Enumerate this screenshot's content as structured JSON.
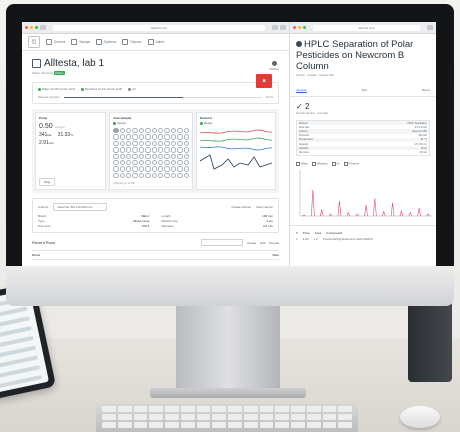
{
  "left": {
    "url": "Alltesta.com",
    "nav": [
      "Devices",
      "Sample",
      "Systems",
      "Reports",
      "Admin"
    ],
    "title": "Alltesta, lab 1",
    "subtitle": "Status: Running",
    "status_pill": "Online",
    "settings_label": "Setting",
    "conditions": [
      "Water  (0.1% formic acid)",
      "Methanol (0.1% formic acid)",
      "Air"
    ],
    "progress_label": "Sample injection",
    "progress_value": "60 %",
    "stop_label": "Stop",
    "panels": {
      "pump": {
        "title": "Pump",
        "value": "0.50",
        "unit": "mL/min",
        "pressure": "341",
        "pressure_unit": "bar",
        "temp": "31.33",
        "temp_unit": "°C",
        "eta": "2.91",
        "eta_unit": "min",
        "stop": "Stop"
      },
      "autosampler": {
        "title": "Autosampler",
        "status": "Ready",
        "label": "Injecting 1 of 96"
      },
      "detector": {
        "title": "Detector",
        "status": "Ready"
      }
    },
    "column": {
      "label": "Column",
      "selected": "Newcrom BH 3.0x100 mm",
      "create": "Create column",
      "view": "View column"
    },
    "column_fields": [
      [
        "Brand",
        "SIELC"
      ],
      [
        "Length",
        "100 mm"
      ],
      [
        "Type",
        "Mixed-mode"
      ],
      [
        "Particle size",
        "3 µm"
      ],
      [
        "Pore size",
        "100 Å"
      ],
      [
        "Diameter",
        "3.0 mm"
      ]
    ],
    "recent": {
      "title": "Recent Runs",
      "search_placeholder": "Search",
      "col1": "Name",
      "col2": "Date",
      "actions": [
        "Create",
        "Edit",
        "Repeat"
      ]
    }
  },
  "right": {
    "url": "alltesta.com",
    "title": "HPLC Separation of Polar Pesticides on Newcrom B Column",
    "meta": "Sample · Created · Newcrom BH",
    "tabs": [
      "Injection",
      "Run",
      "Rerun"
    ],
    "run_number": "2",
    "run_sub": "Sample injection · Complete",
    "rows": [
      [
        "Method",
        "HPLC Separation"
      ],
      [
        "Flow rate",
        "0.5 mL/min"
      ],
      [
        "Column",
        "Newcrom BH"
      ],
      [
        "Pressure",
        "341 bar"
      ],
      [
        "Temperature",
        "31 °C"
      ],
      [
        "Detector",
        "UV 270 nm"
      ],
      [
        "Injection",
        "10 µL"
      ],
      [
        "Run time",
        "15 min"
      ]
    ],
    "legend": [
      "Water",
      "Methanol",
      "Air",
      "Pressure"
    ],
    "peaks_title": "Peaks",
    "peaks_cols": [
      "#",
      "Time",
      "Area",
      "Compound"
    ],
    "peak_row": [
      "1",
      "4.03",
      "1.2",
      "Aminomethylphosphonic acid (AMPA)"
    ]
  },
  "chart_data": {
    "type": "line",
    "x": [
      0,
      1,
      2,
      3,
      4,
      5,
      6,
      7,
      8,
      9,
      10,
      11,
      12,
      13,
      14
    ],
    "values": [
      0.02,
      0.6,
      0.15,
      0.05,
      0.35,
      0.08,
      0.05,
      0.25,
      0.4,
      0.1,
      0.3,
      0.12,
      0.08,
      0.18,
      0.05
    ],
    "ylim": [
      0,
      1
    ]
  }
}
